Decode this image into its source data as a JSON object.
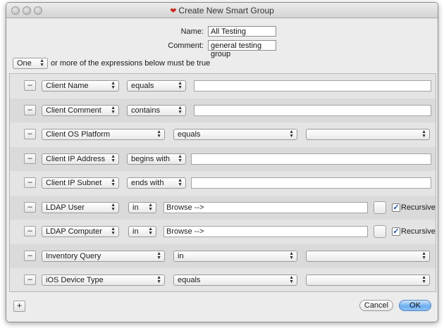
{
  "window": {
    "title": "Create New Smart Group",
    "title_icon": "casper-diamond-icon"
  },
  "form": {
    "name_label": "Name:",
    "name_value": "All Testing",
    "comment_label": "Comment:",
    "comment_value": "general testing group"
  },
  "match": {
    "selector": "One",
    "text": "or more of the expressions below must be true"
  },
  "rules": [
    {
      "remove": "–",
      "field": "Client Name",
      "operator": "equals",
      "value_type": "text",
      "value": ""
    },
    {
      "remove": "–",
      "field": "Client Comment",
      "operator": "contains",
      "value_type": "text",
      "value": ""
    },
    {
      "remove": "–",
      "field": "Client OS Platform",
      "operator": "equals",
      "value_type": "popup",
      "value": ""
    },
    {
      "remove": "–",
      "field": "Client IP Address",
      "operator": "begins with",
      "value_type": "text",
      "value": ""
    },
    {
      "remove": "–",
      "field": "Client IP Subnet",
      "operator": "ends with",
      "value_type": "text",
      "value": ""
    },
    {
      "remove": "–",
      "field": "LDAP User",
      "operator": "in",
      "value_type": "browse",
      "value": "Browse -->",
      "recursive_label": "Recursive",
      "recursive_checked": true
    },
    {
      "remove": "–",
      "field": "LDAP Computer",
      "operator": "in",
      "value_type": "browse",
      "value": "Browse -->",
      "recursive_label": "Recursive",
      "recursive_checked": true
    },
    {
      "remove": "–",
      "field": "Inventory Query",
      "operator": "in",
      "value_type": "popup",
      "value": ""
    },
    {
      "remove": "–",
      "field": "iOS Device Type",
      "operator": "equals",
      "value_type": "popup",
      "value": ""
    }
  ],
  "footer": {
    "add": "+",
    "cancel": "Cancel",
    "ok": "OK"
  },
  "colors": {
    "ok_accent": "#6eaef0",
    "title_icon_red": "#c8281e",
    "checkmark_blue": "#1a4fa6"
  }
}
